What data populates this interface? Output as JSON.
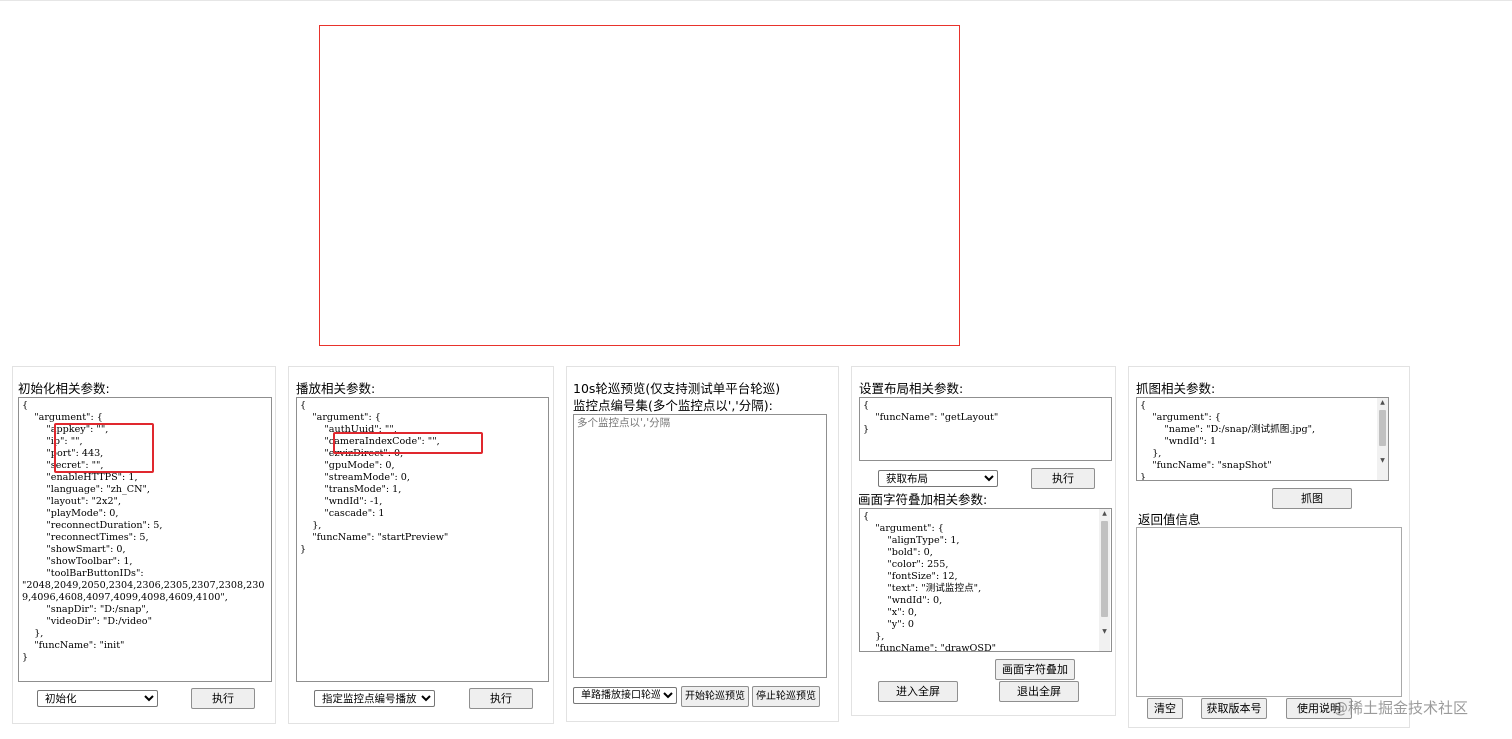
{
  "init_panel": {
    "title": "初始化相关参数:",
    "code": "{\n    \"argument\": {\n        \"appkey\": \"\",\n        \"ip\": \"\",\n        \"port\": 443,\n        \"secret\": \"\",\n        \"enableHTTPS\": 1,\n        \"language\": \"zh_CN\",\n        \"layout\": \"2x2\",\n        \"playMode\": 0,\n        \"reconnectDuration\": 5,\n        \"reconnectTimes\": 5,\n        \"showSmart\": 0,\n        \"showToolbar\": 1,\n        \"toolBarButtonIDs\":\n\"2048,2049,2050,2304,2306,2305,2307,2308,230\n9,4096,4608,4097,4099,4098,4609,4100\",\n        \"snapDir\": \"D:/snap\",\n        \"videoDir\": \"D:/video\"\n    },\n    \"funcName\": \"init\"\n}",
    "select_value": "初始化",
    "exec_label": "执行"
  },
  "play_panel": {
    "title": "播放相关参数:",
    "code": "{\n    \"argument\": {\n        \"authUuid\": \"\",\n        \"cameraIndexCode\": \"\",\n        \"ezvizDirect\": 0,\n        \"gpuMode\": 0,\n        \"streamMode\": 0,\n        \"transMode\": 1,\n        \"wndId\": -1,\n        \"cascade\": 1\n    },\n    \"funcName\": \"startPreview\"\n}",
    "select_value": "指定监控点编号播放",
    "exec_label": "执行"
  },
  "patrol_panel": {
    "title": "10s轮巡预览(仅支持测试单平台轮巡)",
    "subtitle": "监控点编号集(多个监控点以','分隔):",
    "placeholder": "多个监控点以','分隔",
    "select_value": "单路播放接口轮巡",
    "start_label": "开始轮巡预览",
    "stop_label": "停止轮巡预览"
  },
  "layout_panel": {
    "title": "设置布局相关参数:",
    "code": "{\n    \"funcName\": \"getLayout\"\n}",
    "select_value": "获取布局",
    "exec_label": "执行",
    "osd_title": "画面字符叠加相关参数:",
    "osd_code": "{\n    \"argument\": {\n        \"alignType\": 1,\n        \"bold\": 0,\n        \"color\": 255,\n        \"fontSize\": 12,\n        \"text\": \"测试监控点\",\n        \"wndId\": 0,\n        \"x\": 0,\n        \"y\": 0\n    },\n    \"funcName\": \"drawOSD\"\n}",
    "osd_label": "画面字符叠加",
    "enter_fullscreen_label": "进入全屏",
    "exit_fullscreen_label": "退出全屏"
  },
  "snap_panel": {
    "title": "抓图相关参数:",
    "code": "{\n    \"argument\": {\n        \"name\": \"D:/snap/测试抓图.jpg\",\n        \"wndId\": 1\n    },\n    \"funcName\": \"snapShot\"\n}",
    "snap_label": "抓图",
    "return_title": "返回值信息",
    "clear_label": "清空",
    "version_label": "获取版本号",
    "help_label": "使用说明"
  },
  "watermark": "@稀土掘金技术社区",
  "colors": {
    "highlight_box": "#e0282e",
    "video_border": "#e8332c"
  }
}
